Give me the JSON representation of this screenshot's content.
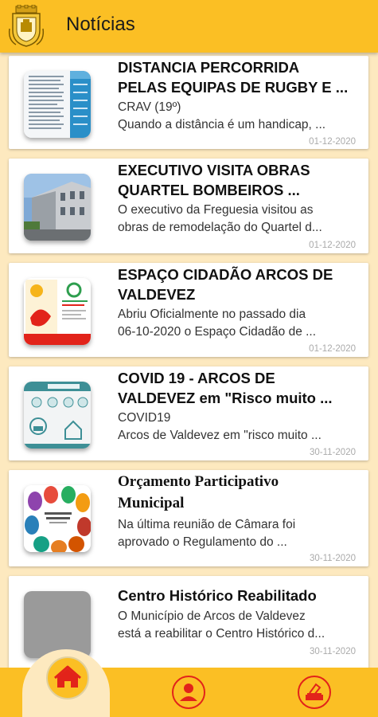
{
  "header": {
    "title": "Notícias",
    "logo_icon": "municipal-crest-icon"
  },
  "colors": {
    "header_bg": "#fbbf24",
    "page_bg": "#fde9bf",
    "nav_icon": "#e2231a"
  },
  "news": [
    {
      "title1": "DISTANCIA PERCORRIDA",
      "title2": "PELAS EQUIPAS DE RUGBY E ...",
      "sub1": "CRAV (19º)",
      "sub2": "Quando a distância é um handicap, ...",
      "date": "01-12-2020",
      "thumb": "spreadsheet-table-image"
    },
    {
      "title1": "EXECUTIVO VISITA OBRAS",
      "title2": "QUARTEL BOMBEIROS ...",
      "sub1": "O executivo da Freguesia visitou as",
      "sub2": "obras de remodelação do Quartel d...",
      "date": "01-12-2020",
      "thumb": "fire-station-building-image"
    },
    {
      "title1": "ESPAÇO CIDADÃO ARCOS DE",
      "title2": "VALDEVEZ",
      "sub1": "Abriu Oficialmente no passado dia",
      "sub2": "06-10-2020 o Espaço Cidadão de ...",
      "date": "01-12-2020",
      "thumb": "citizen-space-poster-image"
    },
    {
      "title1": "COVID 19 - ARCOS DE",
      "title2": "VALDEVEZ em \"Risco muito ...",
      "sub1": "COVID19",
      "sub2": "Arcos de Valdevez em \"risco muito ...",
      "date": "30-11-2020",
      "thumb": "covid-guidelines-infographic-image"
    },
    {
      "title1": "Orçamento Participativo",
      "title2": "Municipal",
      "sub1": "Na última reunião de Câmara foi",
      "sub2": "aprovado o Regulamento do ...",
      "date": "30-11-2020",
      "thumb": "participatory-budget-hands-image"
    },
    {
      "title1": "Centro Histórico Reabilitado",
      "title2": "",
      "sub1": "O Município de Arcos de Valdevez",
      "sub2": "está a reabilitar o Centro Histórico d...",
      "date": "30-11-2020",
      "thumb": "placeholder-image"
    }
  ],
  "nav": {
    "home_icon": "home-icon",
    "profile_icon": "user-icon",
    "vote_icon": "ballot-box-icon"
  }
}
